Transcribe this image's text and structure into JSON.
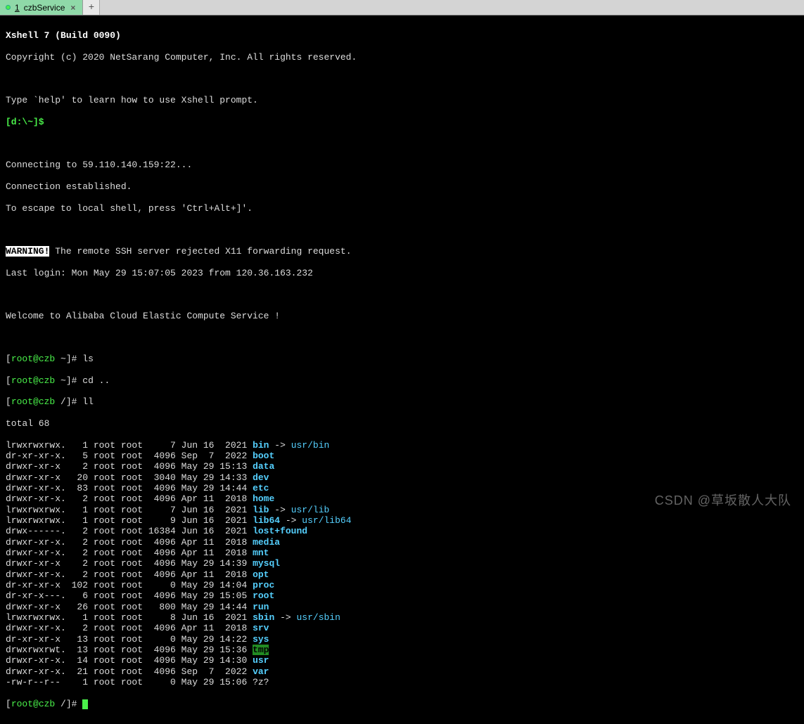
{
  "tab": {
    "num": "1",
    "label": "czbService",
    "close": "×",
    "add": "+"
  },
  "header": {
    "version": "Xshell 7 (Build 0090)",
    "copyright": "Copyright (c) 2020 NetSarang Computer, Inc. All rights reserved.",
    "help_line": "Type `help' to learn how to use Xshell prompt.",
    "local_prompt": "[d:\\~]$",
    "conn1": "Connecting to 59.110.140.159:22...",
    "conn2": "Connection established.",
    "conn3": "To escape to local shell, press 'Ctrl+Alt+]'.",
    "warning_label": "WARNING!",
    "warning_text": " The remote SSH server rejected X11 forwarding request.",
    "last_login": "Last login: Mon May 29 15:07:05 2023 from 120.36.163.232",
    "welcome": "Welcome to Alibaba Cloud Elastic Compute Service !"
  },
  "prompts": {
    "p1_user": "root@czb",
    "p1_path": "~",
    "p1_cmd": "ls",
    "p2_user": "root@czb",
    "p2_path": "~",
    "p2_cmd": "cd ..",
    "p3_user": "root@czb",
    "p3_path": "/",
    "p3_cmd": "ll",
    "p4_user": "root@czb",
    "p4_path": "/"
  },
  "ls_total": "total 68",
  "entries": [
    {
      "perm": "lrwxrwxrwx.",
      "n": "1",
      "o": "root",
      "g": "root",
      "size": "7",
      "date": "Jun 16  2021",
      "name": "bin",
      "type": "link",
      "target": "usr/bin"
    },
    {
      "perm": "dr-xr-xr-x.",
      "n": "5",
      "o": "root",
      "g": "root",
      "size": "4096",
      "date": "Sep  7  2022",
      "name": "boot",
      "type": "dir"
    },
    {
      "perm": "drwxr-xr-x",
      "n": "2",
      "o": "root",
      "g": "root",
      "size": "4096",
      "date": "May 29 15:13",
      "name": "data",
      "type": "dir"
    },
    {
      "perm": "drwxr-xr-x",
      "n": "20",
      "o": "root",
      "g": "root",
      "size": "3040",
      "date": "May 29 14:33",
      "name": "dev",
      "type": "dir"
    },
    {
      "perm": "drwxr-xr-x.",
      "n": "83",
      "o": "root",
      "g": "root",
      "size": "4096",
      "date": "May 29 14:44",
      "name": "etc",
      "type": "dir"
    },
    {
      "perm": "drwxr-xr-x.",
      "n": "2",
      "o": "root",
      "g": "root",
      "size": "4096",
      "date": "Apr 11  2018",
      "name": "home",
      "type": "dir"
    },
    {
      "perm": "lrwxrwxrwx.",
      "n": "1",
      "o": "root",
      "g": "root",
      "size": "7",
      "date": "Jun 16  2021",
      "name": "lib",
      "type": "link",
      "target": "usr/lib"
    },
    {
      "perm": "lrwxrwxrwx.",
      "n": "1",
      "o": "root",
      "g": "root",
      "size": "9",
      "date": "Jun 16  2021",
      "name": "lib64",
      "type": "link",
      "target": "usr/lib64"
    },
    {
      "perm": "drwx------.",
      "n": "2",
      "o": "root",
      "g": "root",
      "size": "16384",
      "date": "Jun 16  2021",
      "name": "lost+found",
      "type": "dir"
    },
    {
      "perm": "drwxr-xr-x.",
      "n": "2",
      "o": "root",
      "g": "root",
      "size": "4096",
      "date": "Apr 11  2018",
      "name": "media",
      "type": "dir"
    },
    {
      "perm": "drwxr-xr-x.",
      "n": "2",
      "o": "root",
      "g": "root",
      "size": "4096",
      "date": "Apr 11  2018",
      "name": "mnt",
      "type": "dir"
    },
    {
      "perm": "drwxr-xr-x",
      "n": "2",
      "o": "root",
      "g": "root",
      "size": "4096",
      "date": "May 29 14:39",
      "name": "mysql",
      "type": "dir"
    },
    {
      "perm": "drwxr-xr-x.",
      "n": "2",
      "o": "root",
      "g": "root",
      "size": "4096",
      "date": "Apr 11  2018",
      "name": "opt",
      "type": "dir"
    },
    {
      "perm": "dr-xr-xr-x",
      "n": "102",
      "o": "root",
      "g": "root",
      "size": "0",
      "date": "May 29 14:04",
      "name": "proc",
      "type": "dir"
    },
    {
      "perm": "dr-xr-x---.",
      "n": "6",
      "o": "root",
      "g": "root",
      "size": "4096",
      "date": "May 29 15:05",
      "name": "root",
      "type": "dir"
    },
    {
      "perm": "drwxr-xr-x",
      "n": "26",
      "o": "root",
      "g": "root",
      "size": "800",
      "date": "May 29 14:44",
      "name": "run",
      "type": "dir"
    },
    {
      "perm": "lrwxrwxrwx.",
      "n": "1",
      "o": "root",
      "g": "root",
      "size": "8",
      "date": "Jun 16  2021",
      "name": "sbin",
      "type": "link",
      "target": "usr/sbin"
    },
    {
      "perm": "drwxr-xr-x.",
      "n": "2",
      "o": "root",
      "g": "root",
      "size": "4096",
      "date": "Apr 11  2018",
      "name": "srv",
      "type": "dir"
    },
    {
      "perm": "dr-xr-xr-x",
      "n": "13",
      "o": "root",
      "g": "root",
      "size": "0",
      "date": "May 29 14:22",
      "name": "sys",
      "type": "dir"
    },
    {
      "perm": "drwxrwxrwt.",
      "n": "13",
      "o": "root",
      "g": "root",
      "size": "4096",
      "date": "May 29 15:36",
      "name": "tmp",
      "type": "tmp"
    },
    {
      "perm": "drwxr-xr-x.",
      "n": "14",
      "o": "root",
      "g": "root",
      "size": "4096",
      "date": "May 29 14:30",
      "name": "usr",
      "type": "dir"
    },
    {
      "perm": "drwxr-xr-x.",
      "n": "21",
      "o": "root",
      "g": "root",
      "size": "4096",
      "date": "Sep  7  2022",
      "name": "var",
      "type": "dir"
    },
    {
      "perm": "-rw-r--r--",
      "n": "1",
      "o": "root",
      "g": "root",
      "size": "0",
      "date": "May 29 15:06",
      "name": "?z?",
      "type": "file"
    }
  ],
  "watermark": "CSDN @草坂散人大队"
}
